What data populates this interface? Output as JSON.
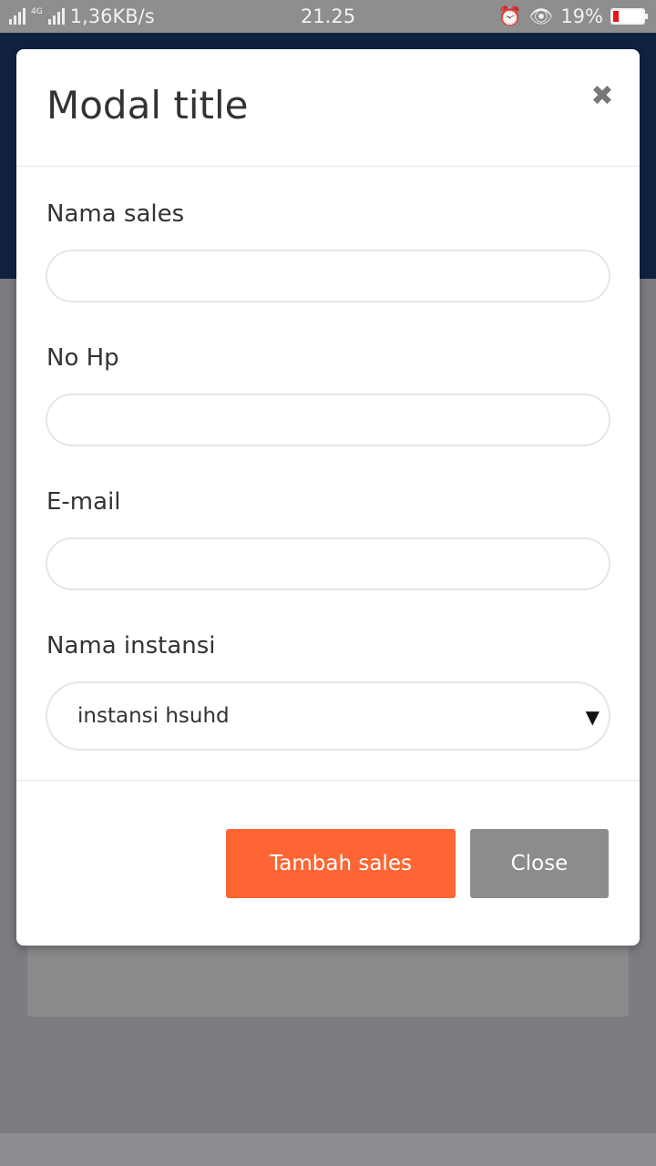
{
  "status_bar": {
    "speed": "1,36KB/s",
    "network": "4G",
    "time": "21.25",
    "battery": "19%",
    "battery_level": 0.19
  },
  "modal": {
    "title": "Modal title",
    "close_icon": "close-icon",
    "fields": [
      {
        "label": "Nama sales",
        "value": "",
        "placeholder": ""
      },
      {
        "label": "No Hp",
        "value": "",
        "placeholder": ""
      },
      {
        "label": "E-mail",
        "value": "",
        "placeholder": ""
      }
    ],
    "select": {
      "label": "Nama instansi",
      "value": "instansi hsuhd"
    },
    "buttons": {
      "submit": "Tambah sales",
      "close": "Close"
    }
  },
  "colors": {
    "primary_button": "#fd6634",
    "close_button": "#8c8c8c",
    "overlay": "#7b7c80"
  }
}
